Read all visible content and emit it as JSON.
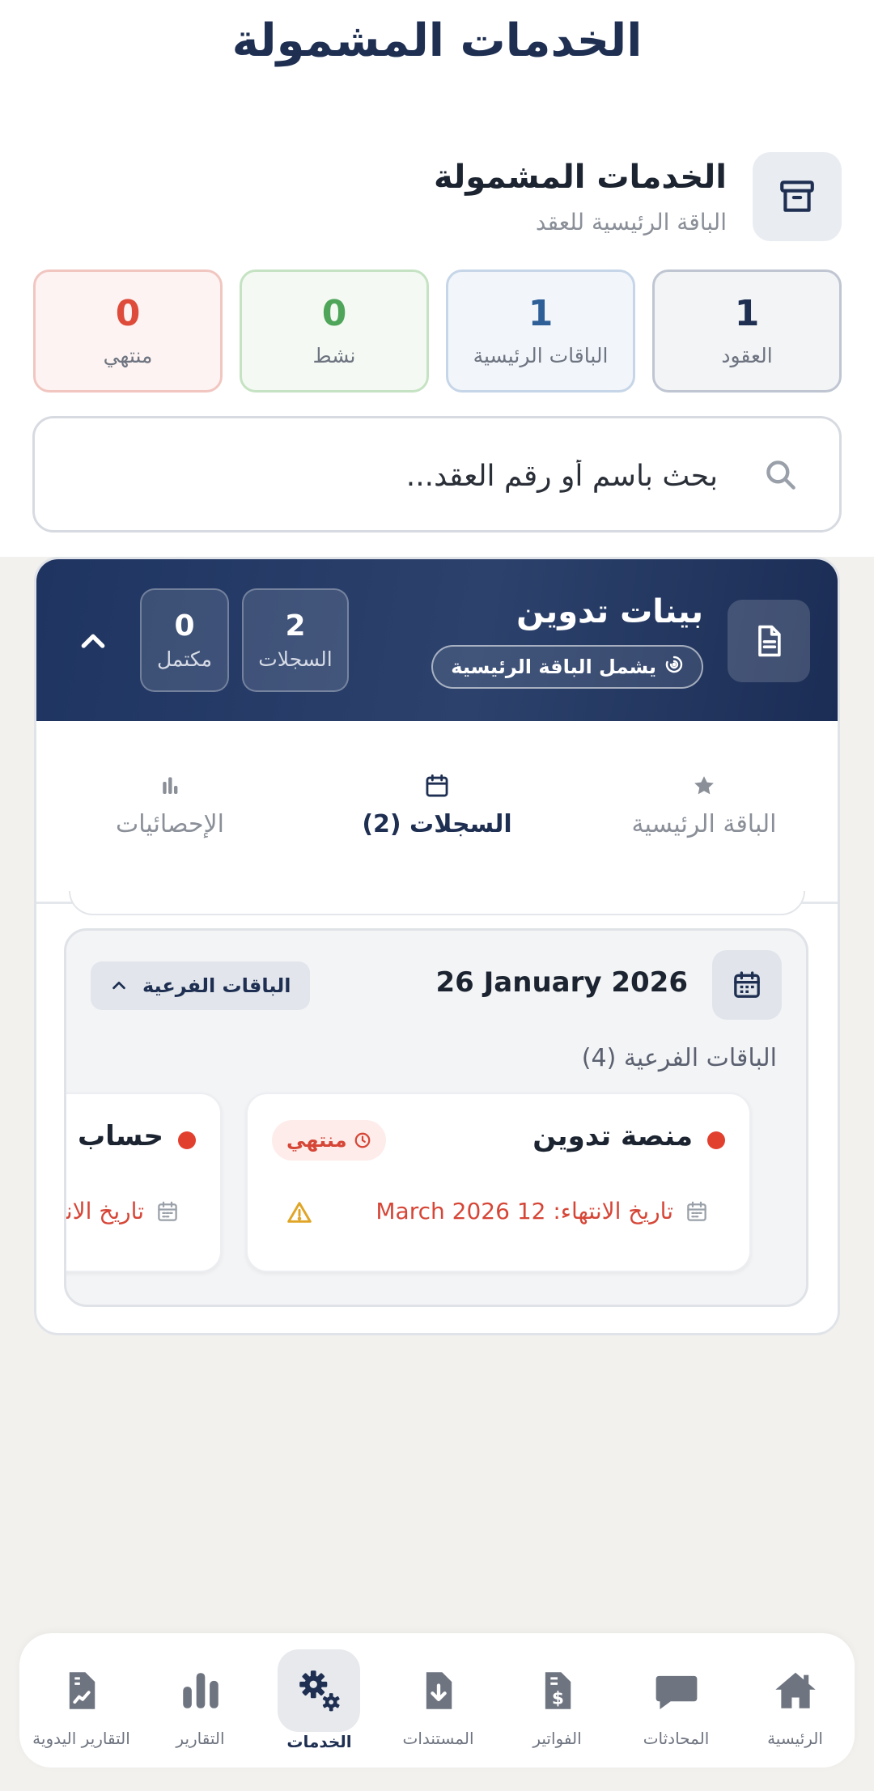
{
  "page": {
    "title": "الخدمات المشمولة"
  },
  "header": {
    "title": "الخدمات المشمولة",
    "subtitle": "الباقة الرئيسية للعقد",
    "icon": "archive-box-icon"
  },
  "stats": [
    {
      "id": "contracts",
      "value": "1",
      "label": "العقود",
      "color": "#1e2f52"
    },
    {
      "id": "main_packages",
      "value": "1",
      "label": "الباقات الرئيسية",
      "color": "#2f5f97"
    },
    {
      "id": "active",
      "value": "0",
      "label": "نشط",
      "color": "#4fa55a"
    },
    {
      "id": "ended",
      "value": "0",
      "label": "منتهي",
      "color": "#de4b3a"
    }
  ],
  "search": {
    "placeholder": "بحث باسم أو رقم العقد...",
    "value": ""
  },
  "card": {
    "title": "بينات تدوين",
    "badge": "يشمل الباقة الرئيسية",
    "records": {
      "value": "2",
      "label": "السجلات"
    },
    "complete": {
      "value": "0",
      "label": "مكتمل"
    },
    "tabs": [
      {
        "id": "main",
        "label": "الباقة الرئيسية",
        "icon": "star-icon"
      },
      {
        "id": "records",
        "label": "السجلات (2)",
        "icon": "calendar-icon",
        "active": true
      },
      {
        "id": "stats",
        "label": "الإحصائيات",
        "icon": "bar-chart-icon"
      }
    ],
    "record": {
      "date": "26 January 2026",
      "subpackages_toggle": "الباقات الفرعية",
      "subpackages_count": "الباقات الفرعية (4)",
      "subpackages": [
        {
          "name": "منصة تدوين",
          "status": "منتهي",
          "end_label": "تاريخ الانتهاء: 12 March 2026"
        },
        {
          "name": "حساب م",
          "end_label": "تاريخ الانتهاء"
        }
      ]
    }
  },
  "nav": [
    {
      "id": "home",
      "label": "الرئيسية",
      "icon": "home-icon"
    },
    {
      "id": "chats",
      "label": "المحادثات",
      "icon": "chat-bubble-icon"
    },
    {
      "id": "invoices",
      "label": "الفواتير",
      "icon": "invoice-dollar-icon"
    },
    {
      "id": "documents",
      "label": "المستندات",
      "icon": "document-download-icon"
    },
    {
      "id": "services",
      "label": "الخدمات",
      "icon": "gears-icon",
      "active": true
    },
    {
      "id": "reports",
      "label": "التقارير",
      "icon": "bar-chart-icon"
    },
    {
      "id": "manual_reports",
      "label": "التقارير اليدوية",
      "icon": "report-document-icon"
    }
  ],
  "colors": {
    "navy": "#1e2f52",
    "danger": "#de4b3a",
    "success": "#4fa55a",
    "info": "#2f5f97",
    "warning": "#e0a526"
  }
}
